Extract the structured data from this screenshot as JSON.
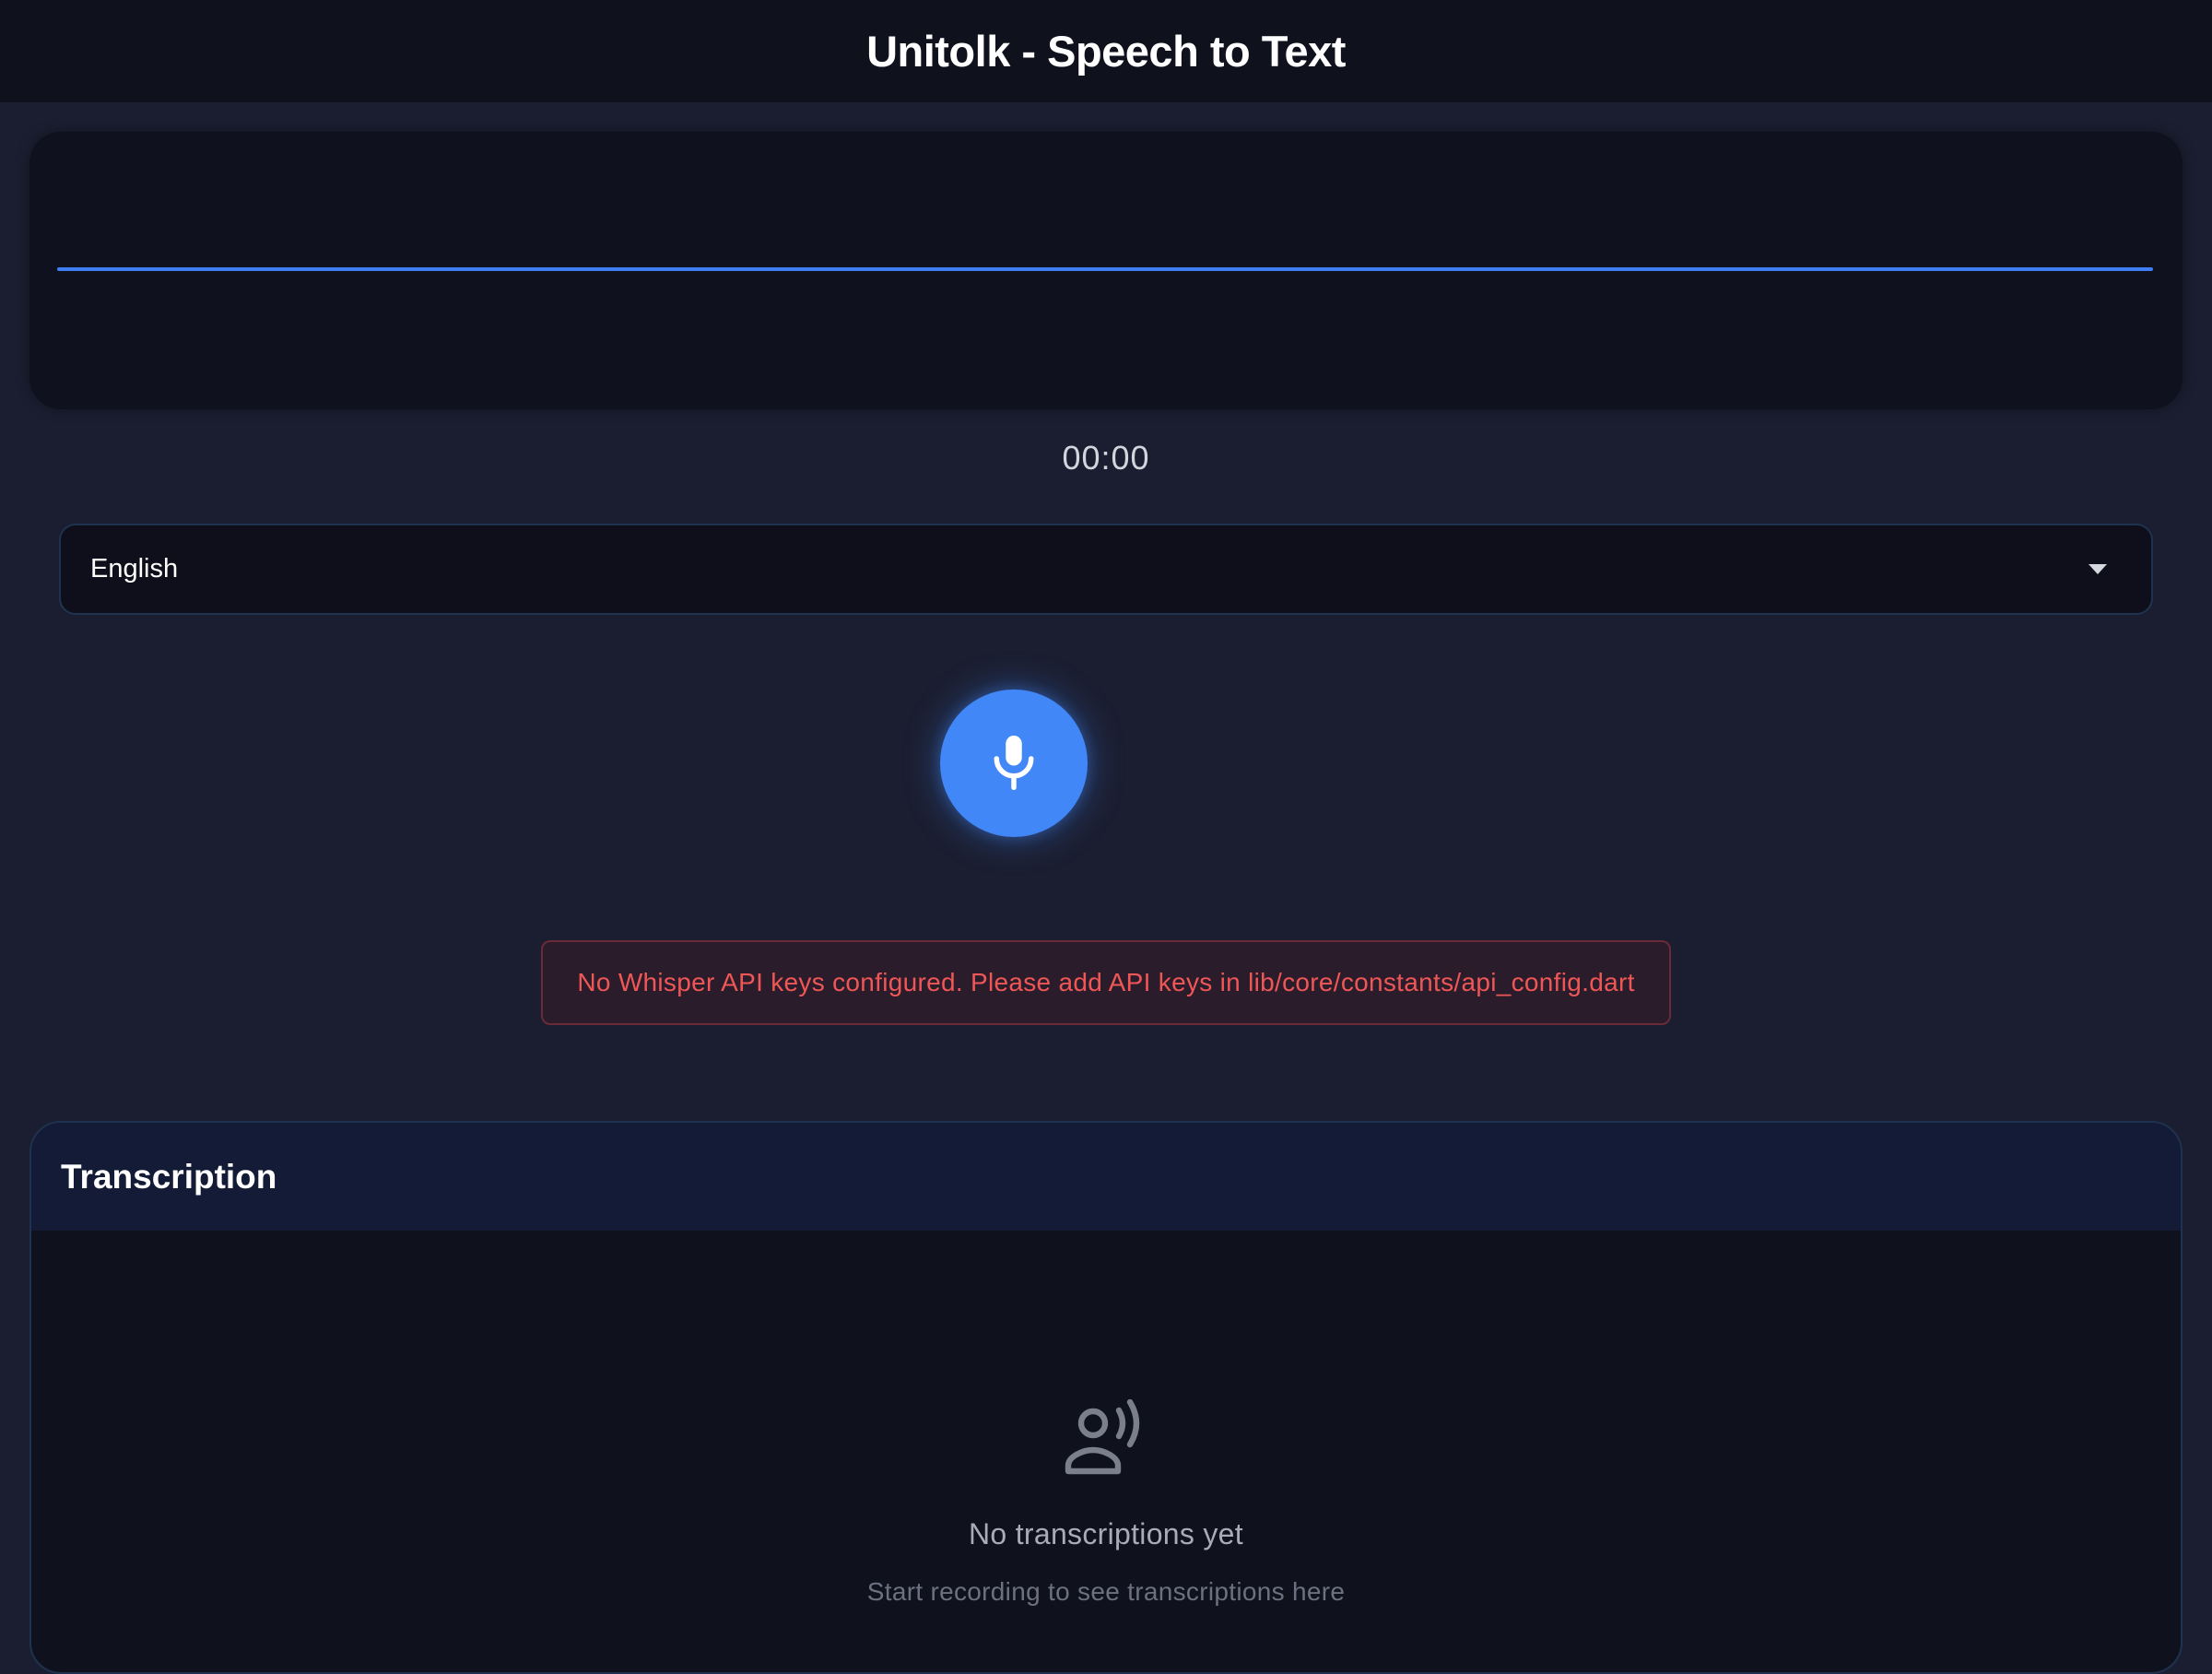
{
  "app": {
    "title": "Unitolk - Speech to Text"
  },
  "recorder": {
    "timer": "00:00",
    "language": "English",
    "mic_icon": "mic-icon"
  },
  "error": {
    "message": "No Whisper API keys configured. Please add API keys in lib/core/constants/api_config.dart"
  },
  "transcription": {
    "title": "Transcription",
    "empty_icon": "record-voice-icon",
    "empty_title": "No transcriptions yet",
    "empty_subtitle": "Start recording to see transcriptions here"
  },
  "colors": {
    "accent": "#4187f8",
    "background": "#1b1e30",
    "error": "#ef5757"
  }
}
